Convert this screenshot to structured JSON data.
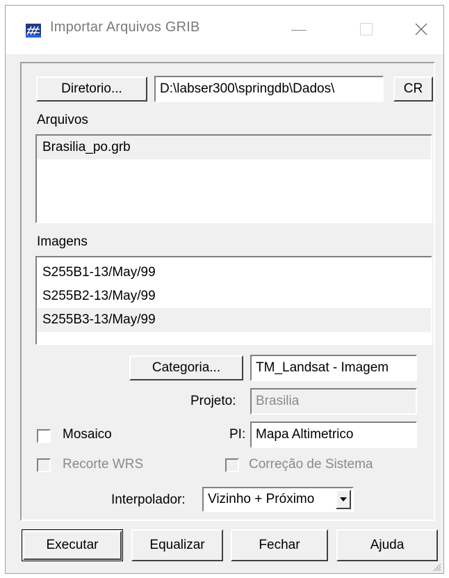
{
  "window": {
    "title": "Importar Arquivos GRIB"
  },
  "top": {
    "directory_button": "Diretorio...",
    "directory_value": "D:\\labser300\\springdb\\Dados\\",
    "cr_button": "CR"
  },
  "arquivos": {
    "label": "Arquivos",
    "items": [
      "Brasilia_po.grb"
    ],
    "selected_index": 0
  },
  "imagens": {
    "label": "Imagens",
    "items": [
      "S255B1-13/May/99",
      "S255B2-13/May/99",
      "S255B3-13/May/99"
    ],
    "selected_index": 2
  },
  "categoria": {
    "button": "Categoria...",
    "value": "TM_Landsat - Imagem"
  },
  "projeto": {
    "label": "Projeto:",
    "value": "Brasilia"
  },
  "mosaico": {
    "label": "Mosaico",
    "checked": false
  },
  "pi": {
    "label": "PI:",
    "value": "Mapa Altimetrico"
  },
  "recorte": {
    "label": "Recorte WRS",
    "checked": false
  },
  "correcao": {
    "label": "Correção de Sistema",
    "checked": false
  },
  "interpolador": {
    "label": "Interpolador:",
    "value": "Vizinho + Próximo"
  },
  "actions": {
    "executar": "Executar",
    "equalizar": "Equalizar",
    "fechar": "Fechar",
    "ajuda": "Ajuda"
  },
  "icons": {
    "app": "grib-grid-icon",
    "minimize": "minimize-icon",
    "maximize": "maximize-icon",
    "close": "close-icon",
    "dropdown": "chevron-down-icon"
  }
}
